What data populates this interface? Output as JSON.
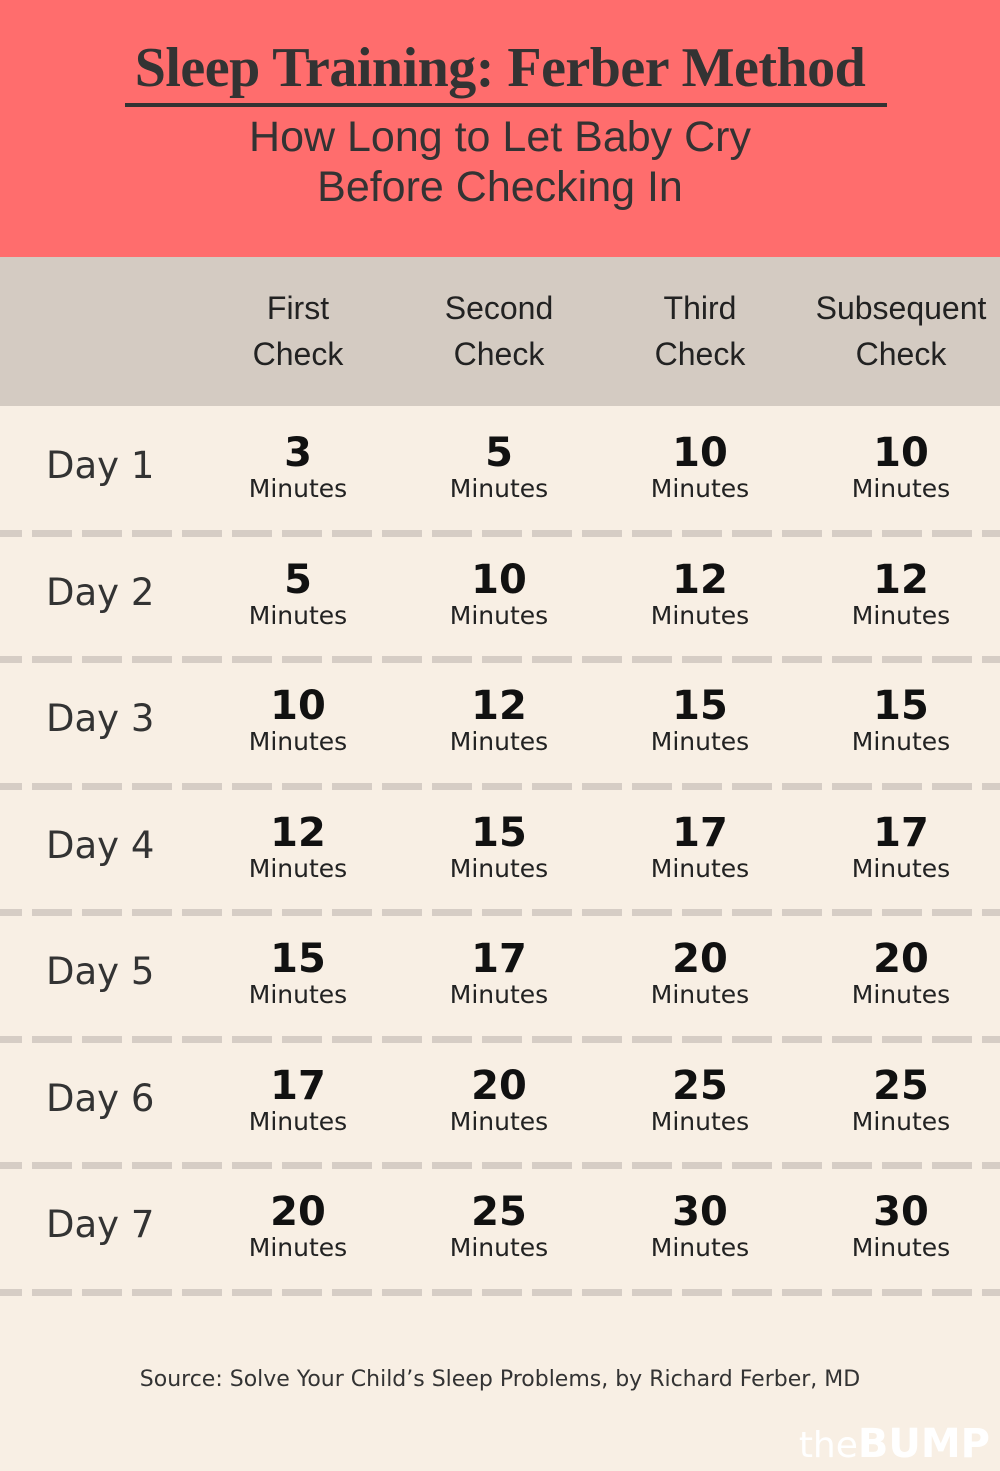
{
  "header": {
    "title": "Sleep Training: Ferber Method",
    "subtitle_line1": "How Long to Let Baby Cry",
    "subtitle_line2": "Before Checking In"
  },
  "colors": {
    "banner": "#ff6d6d",
    "header_row": "#d4cbc2",
    "background": "#f8efe4",
    "divider": "#d6cdc5"
  },
  "table": {
    "columns": [
      "First\nCheck",
      "Second\nCheck",
      "Third\nCheck",
      "Subsequent\nCheck"
    ],
    "unit": "Minutes",
    "rows": [
      {
        "day": "Day 1",
        "values": [
          "3",
          "5",
          "10",
          "10"
        ]
      },
      {
        "day": "Day 2",
        "values": [
          "5",
          "10",
          "12",
          "12"
        ]
      },
      {
        "day": "Day 3",
        "values": [
          "10",
          "12",
          "15",
          "15"
        ]
      },
      {
        "day": "Day 4",
        "values": [
          "12",
          "15",
          "17",
          "17"
        ]
      },
      {
        "day": "Day 5",
        "values": [
          "15",
          "17",
          "20",
          "20"
        ]
      },
      {
        "day": "Day 6",
        "values": [
          "17",
          "20",
          "25",
          "25"
        ]
      },
      {
        "day": "Day 7",
        "values": [
          "20",
          "25",
          "30",
          "30"
        ]
      }
    ]
  },
  "source": "Source: Solve Your Child’s Sleep Problems, by Richard Ferber, MD",
  "logo": {
    "the": "the",
    "bump": "BUMP"
  }
}
